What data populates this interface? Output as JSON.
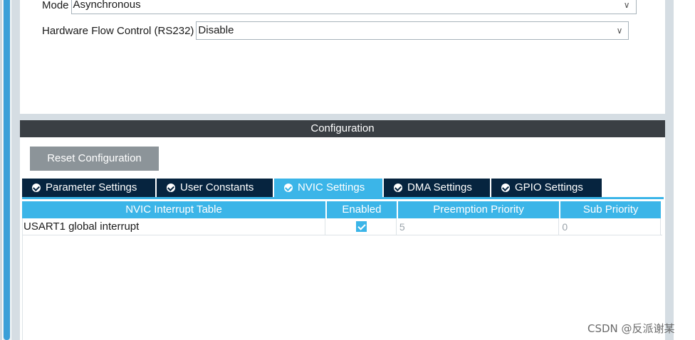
{
  "parameters": {
    "mode": {
      "label": "Mode",
      "value": "Asynchronous"
    },
    "flow_control": {
      "label": "Hardware Flow Control (RS232)",
      "value": "Disable"
    }
  },
  "configuration": {
    "header": "Configuration",
    "reset_button": "Reset Configuration",
    "tabs": [
      {
        "label": "Parameter Settings",
        "active": false
      },
      {
        "label": "User Constants",
        "active": false
      },
      {
        "label": "NVIC Settings",
        "active": true
      },
      {
        "label": "DMA Settings",
        "active": false
      },
      {
        "label": "GPIO Settings",
        "active": false
      }
    ],
    "table": {
      "columns": [
        "NVIC Interrupt Table",
        "Enabled",
        "Preemption Priority",
        "Sub Priority"
      ],
      "rows": [
        {
          "name": "USART1 global interrupt",
          "enabled": true,
          "preemption": "5",
          "sub": "0"
        }
      ]
    }
  },
  "watermark": "CSDN @反派谢某",
  "colors": {
    "accent": "#3bb5e8",
    "tab_dark": "#06243f",
    "header_bg": "#3a3f44",
    "button_gray": "#8c9499"
  }
}
